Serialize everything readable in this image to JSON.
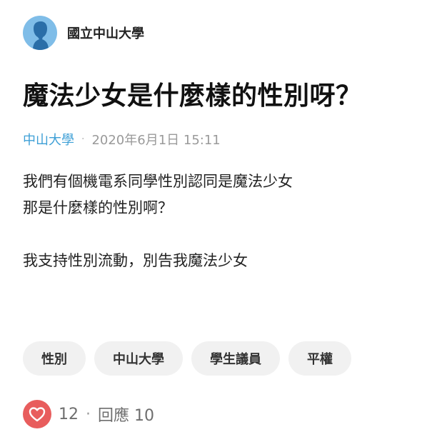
{
  "forum": {
    "name": "國立中山大學",
    "avatar_color": "#7fbde8"
  },
  "post": {
    "title": "魔法少女是什麼樣的性別呀？",
    "school": "中山大學",
    "separator": "·",
    "timestamp": "2020年6月1日 15:11",
    "content_lines": [
      "我們有個機電系同學性別認同是魔法少女",
      "那是什麼樣的性別啊？",
      "",
      "我支持性別流動，別告我魔法少女"
    ]
  },
  "tags": [
    "性別",
    "中山大學",
    "學生議員",
    "平權"
  ],
  "footer": {
    "like_icon": "heart-icon",
    "like_color": "#e85d5d",
    "likes": "12",
    "separator": "·",
    "replies": "回應 10"
  },
  "colors": {
    "school_link": "#3d9fd6",
    "meta_gray": "#9a9a9a",
    "tag_bg": "#f1f1f1"
  }
}
